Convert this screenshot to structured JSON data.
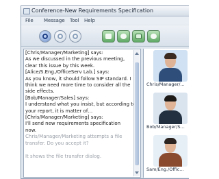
{
  "window": {
    "title": "Conference-New Requirements Specification"
  },
  "menu": {
    "items": [
      "File",
      "Message",
      "Tool",
      "Help"
    ]
  },
  "toolbar": {
    "buttons": [
      {
        "name": "conference-icon",
        "active": true
      },
      {
        "name": "record-icon",
        "active": false
      },
      {
        "name": "phone-icon",
        "active": false
      }
    ],
    "actions": [
      {
        "name": "send-file-icon"
      },
      {
        "name": "whiteboard-icon"
      },
      {
        "name": "contact-card-icon"
      },
      {
        "name": "video-icon"
      }
    ]
  },
  "chat": {
    "lines": [
      {
        "text": "[Chris/Manager/Marketing] says:",
        "system": false
      },
      {
        "text": "As we discussed in the previous meeting,",
        "system": false
      },
      {
        "text": "clear this issue by this week.",
        "system": false
      },
      {
        "text": "[Alice/S.Eng./OfficeServ Lab.] says:",
        "system": false
      },
      {
        "text": "As you know, it should follow SIP standard. I",
        "system": false
      },
      {
        "text": "think we need more time to consider all the",
        "system": false
      },
      {
        "text": "side effects.",
        "system": false
      },
      {
        "text": "[Bob/Manager/Sales] says:",
        "system": false
      },
      {
        "text": "I understand what you insist, but according to",
        "system": false
      },
      {
        "text": "your report, it is matter of…",
        "system": false
      },
      {
        "text": "[Chris/Manager/Marketing] says:",
        "system": false
      },
      {
        "text": "I'll send new requirements specification",
        "system": false
      },
      {
        "text": "now.",
        "system": false
      },
      {
        "text": "Chris/Manager/Marketing attempts a file",
        "system": true
      },
      {
        "text": "transfer. Do you accept it?",
        "system": true
      },
      {
        "text": "",
        "system": true
      },
      {
        "text": "It shows the file transfer dialog.",
        "system": true
      }
    ]
  },
  "participants": [
    {
      "label": "Chris/Manager/...",
      "colors": {
        "bg": "#cfe1f2",
        "hair": "#3b2a20",
        "body": "#2f4f7a"
      }
    },
    {
      "label": "Bob/Manager/S...",
      "colors": {
        "bg": "#d9e4ef",
        "hair": "#1e1a18",
        "body": "#23303f"
      }
    },
    {
      "label": "Sam/Eng./Offic...",
      "colors": {
        "bg": "#e6eef6",
        "hair": "#2a2320",
        "body": "#8a4a2e"
      }
    }
  ]
}
